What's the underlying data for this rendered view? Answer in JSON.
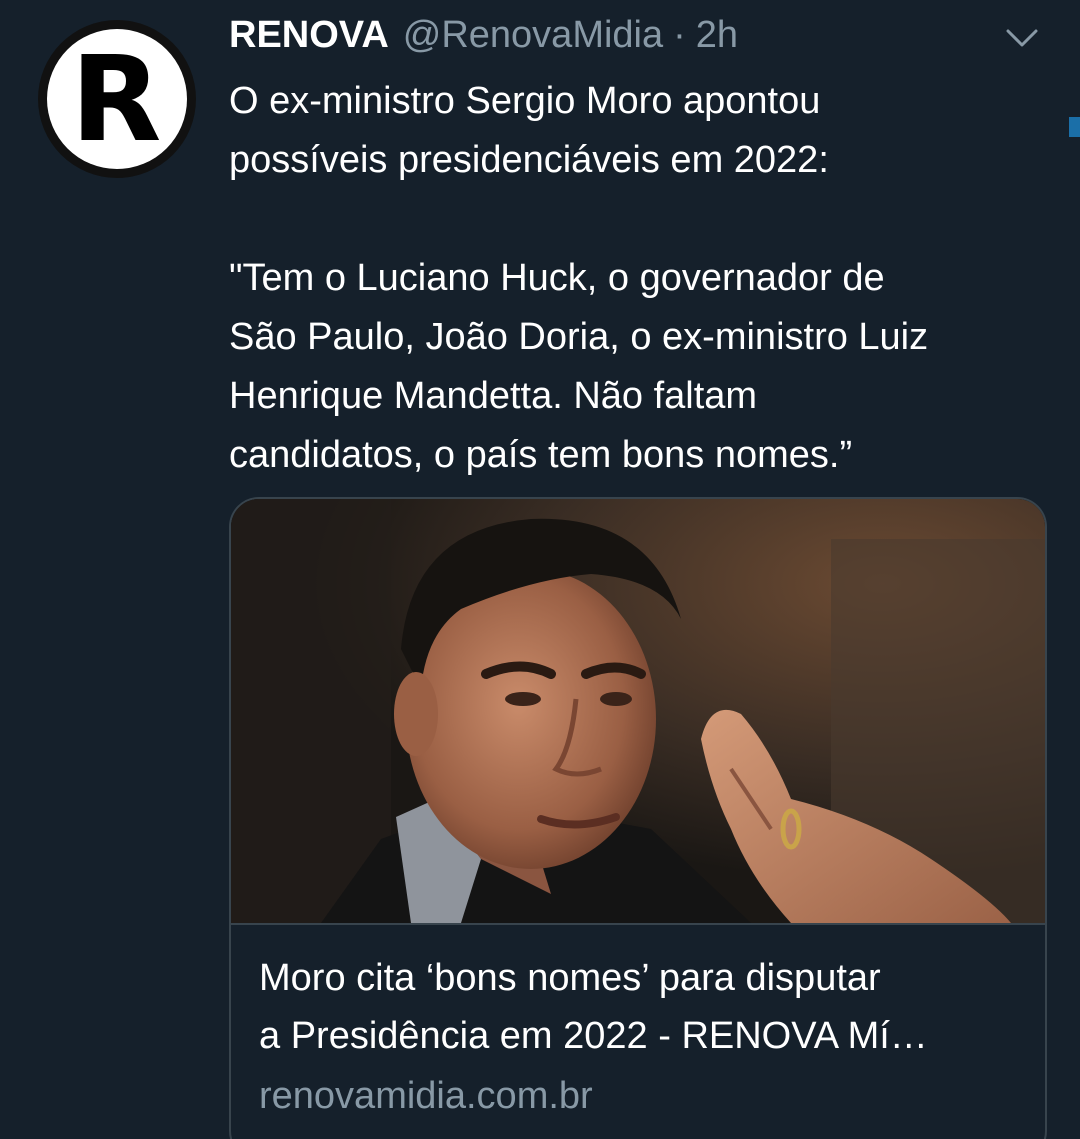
{
  "tweet": {
    "avatar_letter": "R",
    "display_name": "RENOVA",
    "handle": "@RenovaMidia",
    "separator": "·",
    "time": "2h",
    "menu_icon": "chevron-down-icon",
    "text_lines_1": [
      "O ex-ministro Sergio Moro apontou",
      "possíveis presidenciáveis em 2022:"
    ],
    "text_lines_2": [
      "\"Tem o Luciano Huck, o governador de",
      "São Paulo, João Doria, o ex-ministro Luiz",
      "Henrique Mandetta. Não faltam",
      "candidatos, o país tem bons nomes.”"
    ]
  },
  "card": {
    "title_line_1": "Moro cita ‘bons nomes’ para disputar",
    "title_line_2": "a Presidência em 2022 - RENOVA Mí…",
    "domain": "renovamidia.com.br"
  },
  "colors": {
    "background": "#15202b",
    "secondary_text": "#8899a6",
    "border": "#38444d",
    "accent": "#1b6fa8"
  }
}
